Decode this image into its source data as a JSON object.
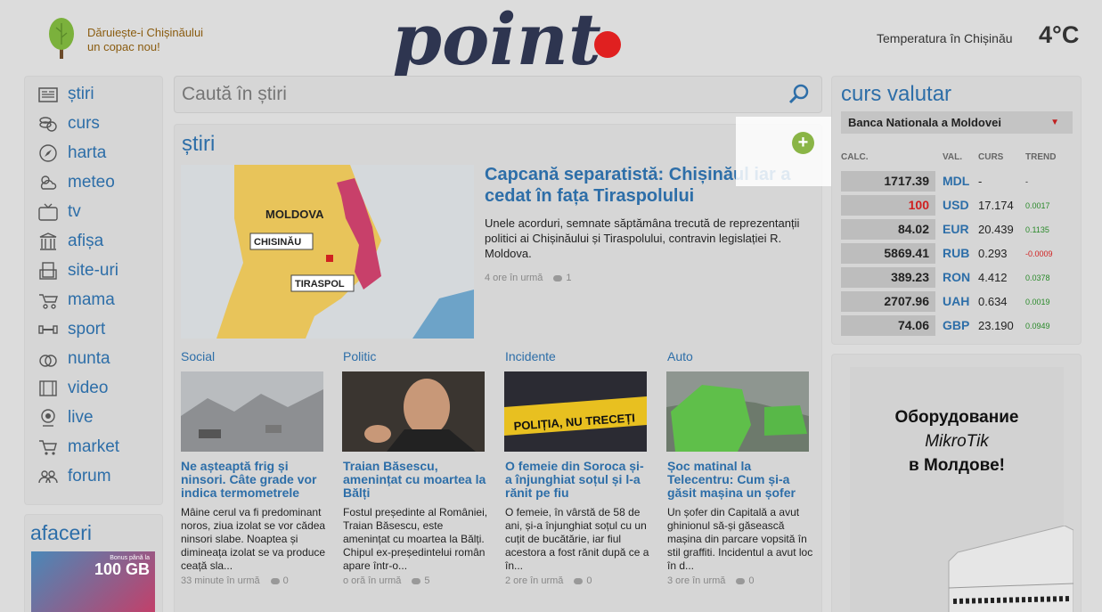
{
  "header": {
    "promo_line1": "Dăruiește-i Chișinăului",
    "promo_line2": "un copac nou!",
    "logo_text": "point",
    "temperature_label": "Temperatura în Chișinău",
    "temperature_value": "4°C"
  },
  "nav": {
    "items": [
      {
        "label": "știri",
        "icon": "newspaper-icon"
      },
      {
        "label": "curs",
        "icon": "coins-icon"
      },
      {
        "label": "harta",
        "icon": "compass-icon"
      },
      {
        "label": "meteo",
        "icon": "weather-icon"
      },
      {
        "label": "tv",
        "icon": "tv-icon"
      },
      {
        "label": "afișa",
        "icon": "theater-icon"
      },
      {
        "label": "site-uri",
        "icon": "sites-icon"
      },
      {
        "label": "mama",
        "icon": "stroller-icon"
      },
      {
        "label": "sport",
        "icon": "dumbbell-icon"
      },
      {
        "label": "nunta",
        "icon": "rings-icon"
      },
      {
        "label": "video",
        "icon": "film-icon"
      },
      {
        "label": "live",
        "icon": "webcam-icon"
      },
      {
        "label": "market",
        "icon": "cart-icon"
      },
      {
        "label": "forum",
        "icon": "people-icon"
      }
    ]
  },
  "afaceri": {
    "title": "afaceri",
    "ad_small": "Bonus până la",
    "ad_big": "100 GB"
  },
  "search": {
    "placeholder": "Caută în știri"
  },
  "news": {
    "section_title": "știri",
    "featured": {
      "title": "Capcană separatistă: Chișinăul iar a cedat în fața Tiraspolului",
      "text": "Unele acorduri, semnate săptămâna trecută de reprezentanții politici ai Chișinăului și Tiraspolului, contravin legislației R. Moldova.",
      "time": "4 ore în urmă",
      "comments": "1",
      "map_labels": [
        "MOLDOVA",
        "CHISINĂU",
        "TIRASPOL"
      ]
    },
    "articles": [
      {
        "category": "Social",
        "title": "Ne așteaptă frig și ninsori. Câte grade vor indica termometrele",
        "text": "Mâine cerul va fi predominant noros, ziua izolat se vor cădea ninsori slabe. Noaptea și dimineața izolat se va produce ceață sla...",
        "time": "33 minute în urmă",
        "comments": "0"
      },
      {
        "category": "Politic",
        "title": "Traian Băsescu, amenințat cu moartea la Bălți",
        "text": "Fostul președinte al României, Traian Băsescu, este amenințat cu moartea la Bălți. Chipul ex-președintelui român apare într-o...",
        "time": "o oră în urmă",
        "comments": "5"
      },
      {
        "category": "Incidente",
        "title": "O femeie din Soroca și-a înjunghiat soțul și l-a rănit pe fiu",
        "text": "O femeie, în vârstă de 58 de ani, și-a înjunghiat soțul cu un cuțit de bucătărie, iar fiul acestora a fost rănit după ce a în...",
        "time": "2 ore în urmă",
        "comments": "0",
        "tape_text": "POLIȚIA, NU TRECEȚI"
      },
      {
        "category": "Auto",
        "title": "Șoc matinal la Telecentru: Cum și-a găsit mașina un șofer",
        "text": "Un șofer din Capitală a avut ghinionul să-și găsească mașina din parcare vopsită în stil graffiti. Incidentul a avut loc în d...",
        "time": "3 ore în urmă",
        "comments": "0"
      }
    ]
  },
  "currency": {
    "title": "curs valutar",
    "bank": "Banca Nationala a Moldovei",
    "headers": {
      "calc": "CALC.",
      "val": "VAL.",
      "curs": "CURS",
      "trend": "TREND"
    },
    "rows": [
      {
        "calc": "1717.39",
        "code": "MDL",
        "rate": "-",
        "trend": "-",
        "trend_color": "#222"
      },
      {
        "calc": "100",
        "code": "USD",
        "rate": "17.174",
        "trend": "0.0017",
        "trend_color": "#2a8a2a",
        "calc_color": "#d02020"
      },
      {
        "calc": "84.02",
        "code": "EUR",
        "rate": "20.439",
        "trend": "0.1135",
        "trend_color": "#2a8a2a"
      },
      {
        "calc": "5869.41",
        "code": "RUB",
        "rate": "0.293",
        "trend": "-0.0009",
        "trend_color": "#d02020"
      },
      {
        "calc": "389.23",
        "code": "RON",
        "rate": "4.412",
        "trend": "0.0378",
        "trend_color": "#2a8a2a"
      },
      {
        "calc": "2707.96",
        "code": "UAH",
        "rate": "0.634",
        "trend": "0.0019",
        "trend_color": "#2a8a2a"
      },
      {
        "calc": "74.06",
        "code": "GBP",
        "rate": "23.190",
        "trend": "0.0949",
        "trend_color": "#2a8a2a"
      }
    ]
  },
  "side_ad": {
    "line1": "Оборудование",
    "line2": "MikroTik",
    "line3": "в Молдове!"
  },
  "colors": {
    "accent": "#2d6ea8",
    "logo": "#2e3550",
    "logo_dot": "#e02020",
    "plus": "#8ab546"
  }
}
